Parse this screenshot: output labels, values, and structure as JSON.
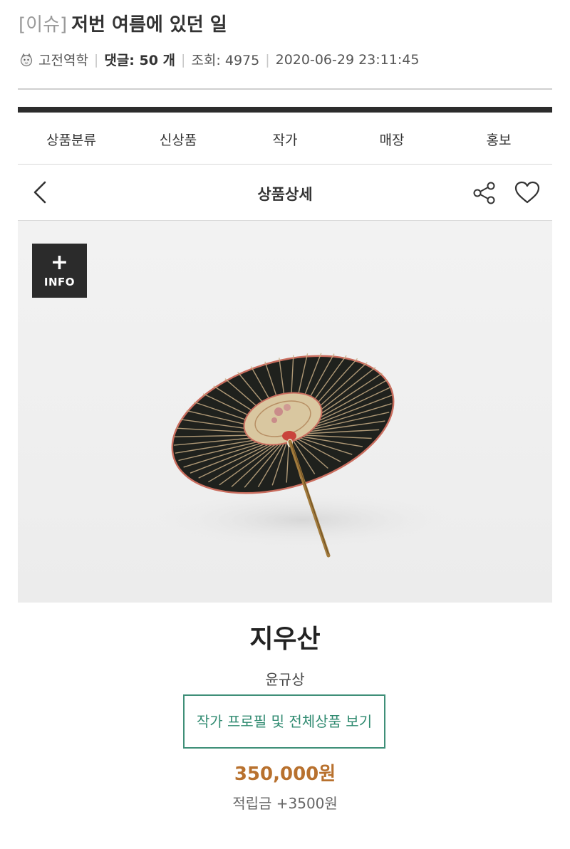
{
  "post": {
    "tag": "[이슈]",
    "title": "저번 여름에 있던 일",
    "author": "고전역학",
    "comments_label": "댓글: 50 개",
    "views_label": "조회: 4975",
    "datetime": "2020-06-29 23:11:45"
  },
  "shop": {
    "nav": [
      "상품분류",
      "신상품",
      "작가",
      "매장",
      "홍보"
    ],
    "detail_title": "상품상세",
    "info_button": {
      "plus": "+",
      "label": "INFO"
    }
  },
  "product": {
    "name": "지우산",
    "artist": "윤규상",
    "profile_button": "작가 프로필 및 전체상품 보기",
    "price": "350,000원",
    "points": "적립금 +3500원"
  },
  "colors": {
    "accent_green": "#2f8a70",
    "price_orange": "#b8712e",
    "bar_dark": "#2c2c2c"
  },
  "icons": [
    "back-chevron-icon",
    "share-icon",
    "heart-icon",
    "avatar-icon"
  ]
}
